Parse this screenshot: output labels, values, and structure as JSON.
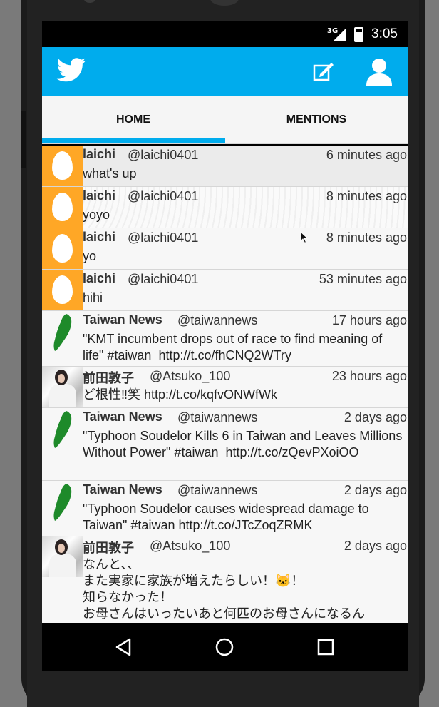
{
  "status_bar": {
    "network": "3G",
    "time": "3:05"
  },
  "app_bar": {
    "logo_icon": "twitter-bird-icon",
    "compose_icon": "compose-icon",
    "profile_icon": "profile-icon",
    "brand_color": "#00aced"
  },
  "tabs": [
    {
      "label": "HOME",
      "active": true
    },
    {
      "label": "MENTIONS",
      "active": false
    }
  ],
  "tweets": [
    {
      "name": "laichi",
      "handle": "@laichi0401",
      "time": "6 minutes ago",
      "text": "what's up",
      "avatar": "egg"
    },
    {
      "name": "laichi",
      "handle": "@laichi0401",
      "time": "8 minutes ago",
      "text": "yoyo",
      "avatar": "egg"
    },
    {
      "name": "laichi",
      "handle": "@laichi0401",
      "time": "8 minutes ago",
      "text": "yo",
      "avatar": "egg"
    },
    {
      "name": "laichi",
      "handle": "@laichi0401",
      "time": "53 minutes ago",
      "text": "hihi",
      "avatar": "egg"
    },
    {
      "name": "Taiwan News",
      "handle": "@taiwannews",
      "time": "17 hours ago",
      "text": "\"KMT incumbent drops out of race to find meaning of life\" #taiwan  http://t.co/fhCNQ2WTry",
      "avatar": "taiwan-map"
    },
    {
      "name": "前田敦子",
      "handle": "@Atsuko_100",
      "time": "23 hours ago",
      "text": "ど根性‼笑 http://t.co/kqfvONWfWk",
      "avatar": "photo"
    },
    {
      "name": "Taiwan News",
      "handle": "@taiwannews",
      "time": "2 days ago",
      "text": "\"Typhoon Soudelor Kills 6 in Taiwan and Leaves Millions Without Power\" #taiwan  http://t.co/zQevPXoiOO",
      "avatar": "taiwan-map"
    },
    {
      "name": "Taiwan News",
      "handle": "@taiwannews",
      "time": "2 days ago",
      "text": "\"Typhoon Soudelor causes widespread damage to Taiwan\" #taiwan http://t.co/JTcZoqZRMK",
      "avatar": "taiwan-map"
    },
    {
      "name": "前田敦子",
      "handle": "@Atsuko_100",
      "time": "2 days ago",
      "text": "なんと、、\nまた実家に家族が増えたらしい！🐱！\n知らなかった！\nお母さんはいったいあと何匹のお母さんになるん",
      "avatar": "photo"
    }
  ],
  "nav_bar": {
    "back_icon": "back-triangle-icon",
    "home_icon": "home-circle-icon",
    "recents_icon": "recents-square-icon"
  }
}
